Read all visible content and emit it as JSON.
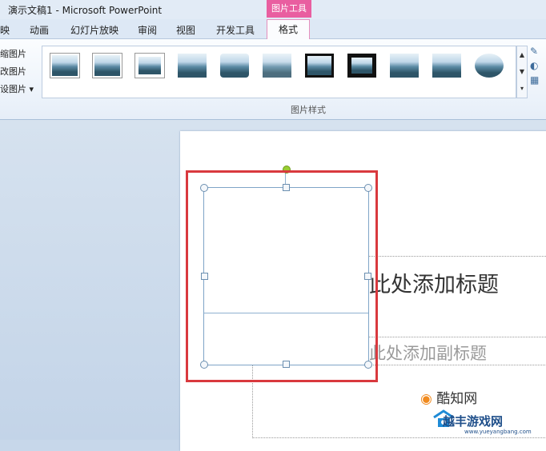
{
  "window": {
    "title": "演示文稿1 - Microsoft PowerPoint",
    "context_tab": "图片工具"
  },
  "tabs": [
    {
      "label": "映"
    },
    {
      "label": "动画"
    },
    {
      "label": "幻灯片放映"
    },
    {
      "label": "审阅"
    },
    {
      "label": "视图"
    },
    {
      "label": "开发工具"
    },
    {
      "label": "格式",
      "active": true
    }
  ],
  "ribbon": {
    "left_items": [
      "缩图片",
      "改图片",
      "设图片 ▾"
    ],
    "group_label": "图片样式",
    "gallery": [
      "picture-style-simple-frame-white",
      "picture-style-soft-edge",
      "picture-style-thick-matte",
      "picture-style-reflected",
      "picture-style-reflected-rounded",
      "picture-style-soft-reflection",
      "picture-style-black-frame",
      "picture-style-thick-black-frame",
      "picture-style-perspective",
      "picture-style-bevel",
      "picture-style-oval",
      "picture-style-metal-frame"
    ],
    "side_icons": [
      "picture-border-icon",
      "picture-effects-icon",
      "picture-layout-icon"
    ]
  },
  "slide": {
    "title_placeholder": "此处添加标题",
    "subtitle_placeholder": "此处添加副标题"
  },
  "watermark": {
    "brand": "酷知网",
    "site_name": "越丰游戏网",
    "url": "www.yueyangbang.com"
  },
  "colors": {
    "context_tab": "#e95ea0",
    "highlight": "#d9393e",
    "handle_rotate": "#9acd32"
  }
}
